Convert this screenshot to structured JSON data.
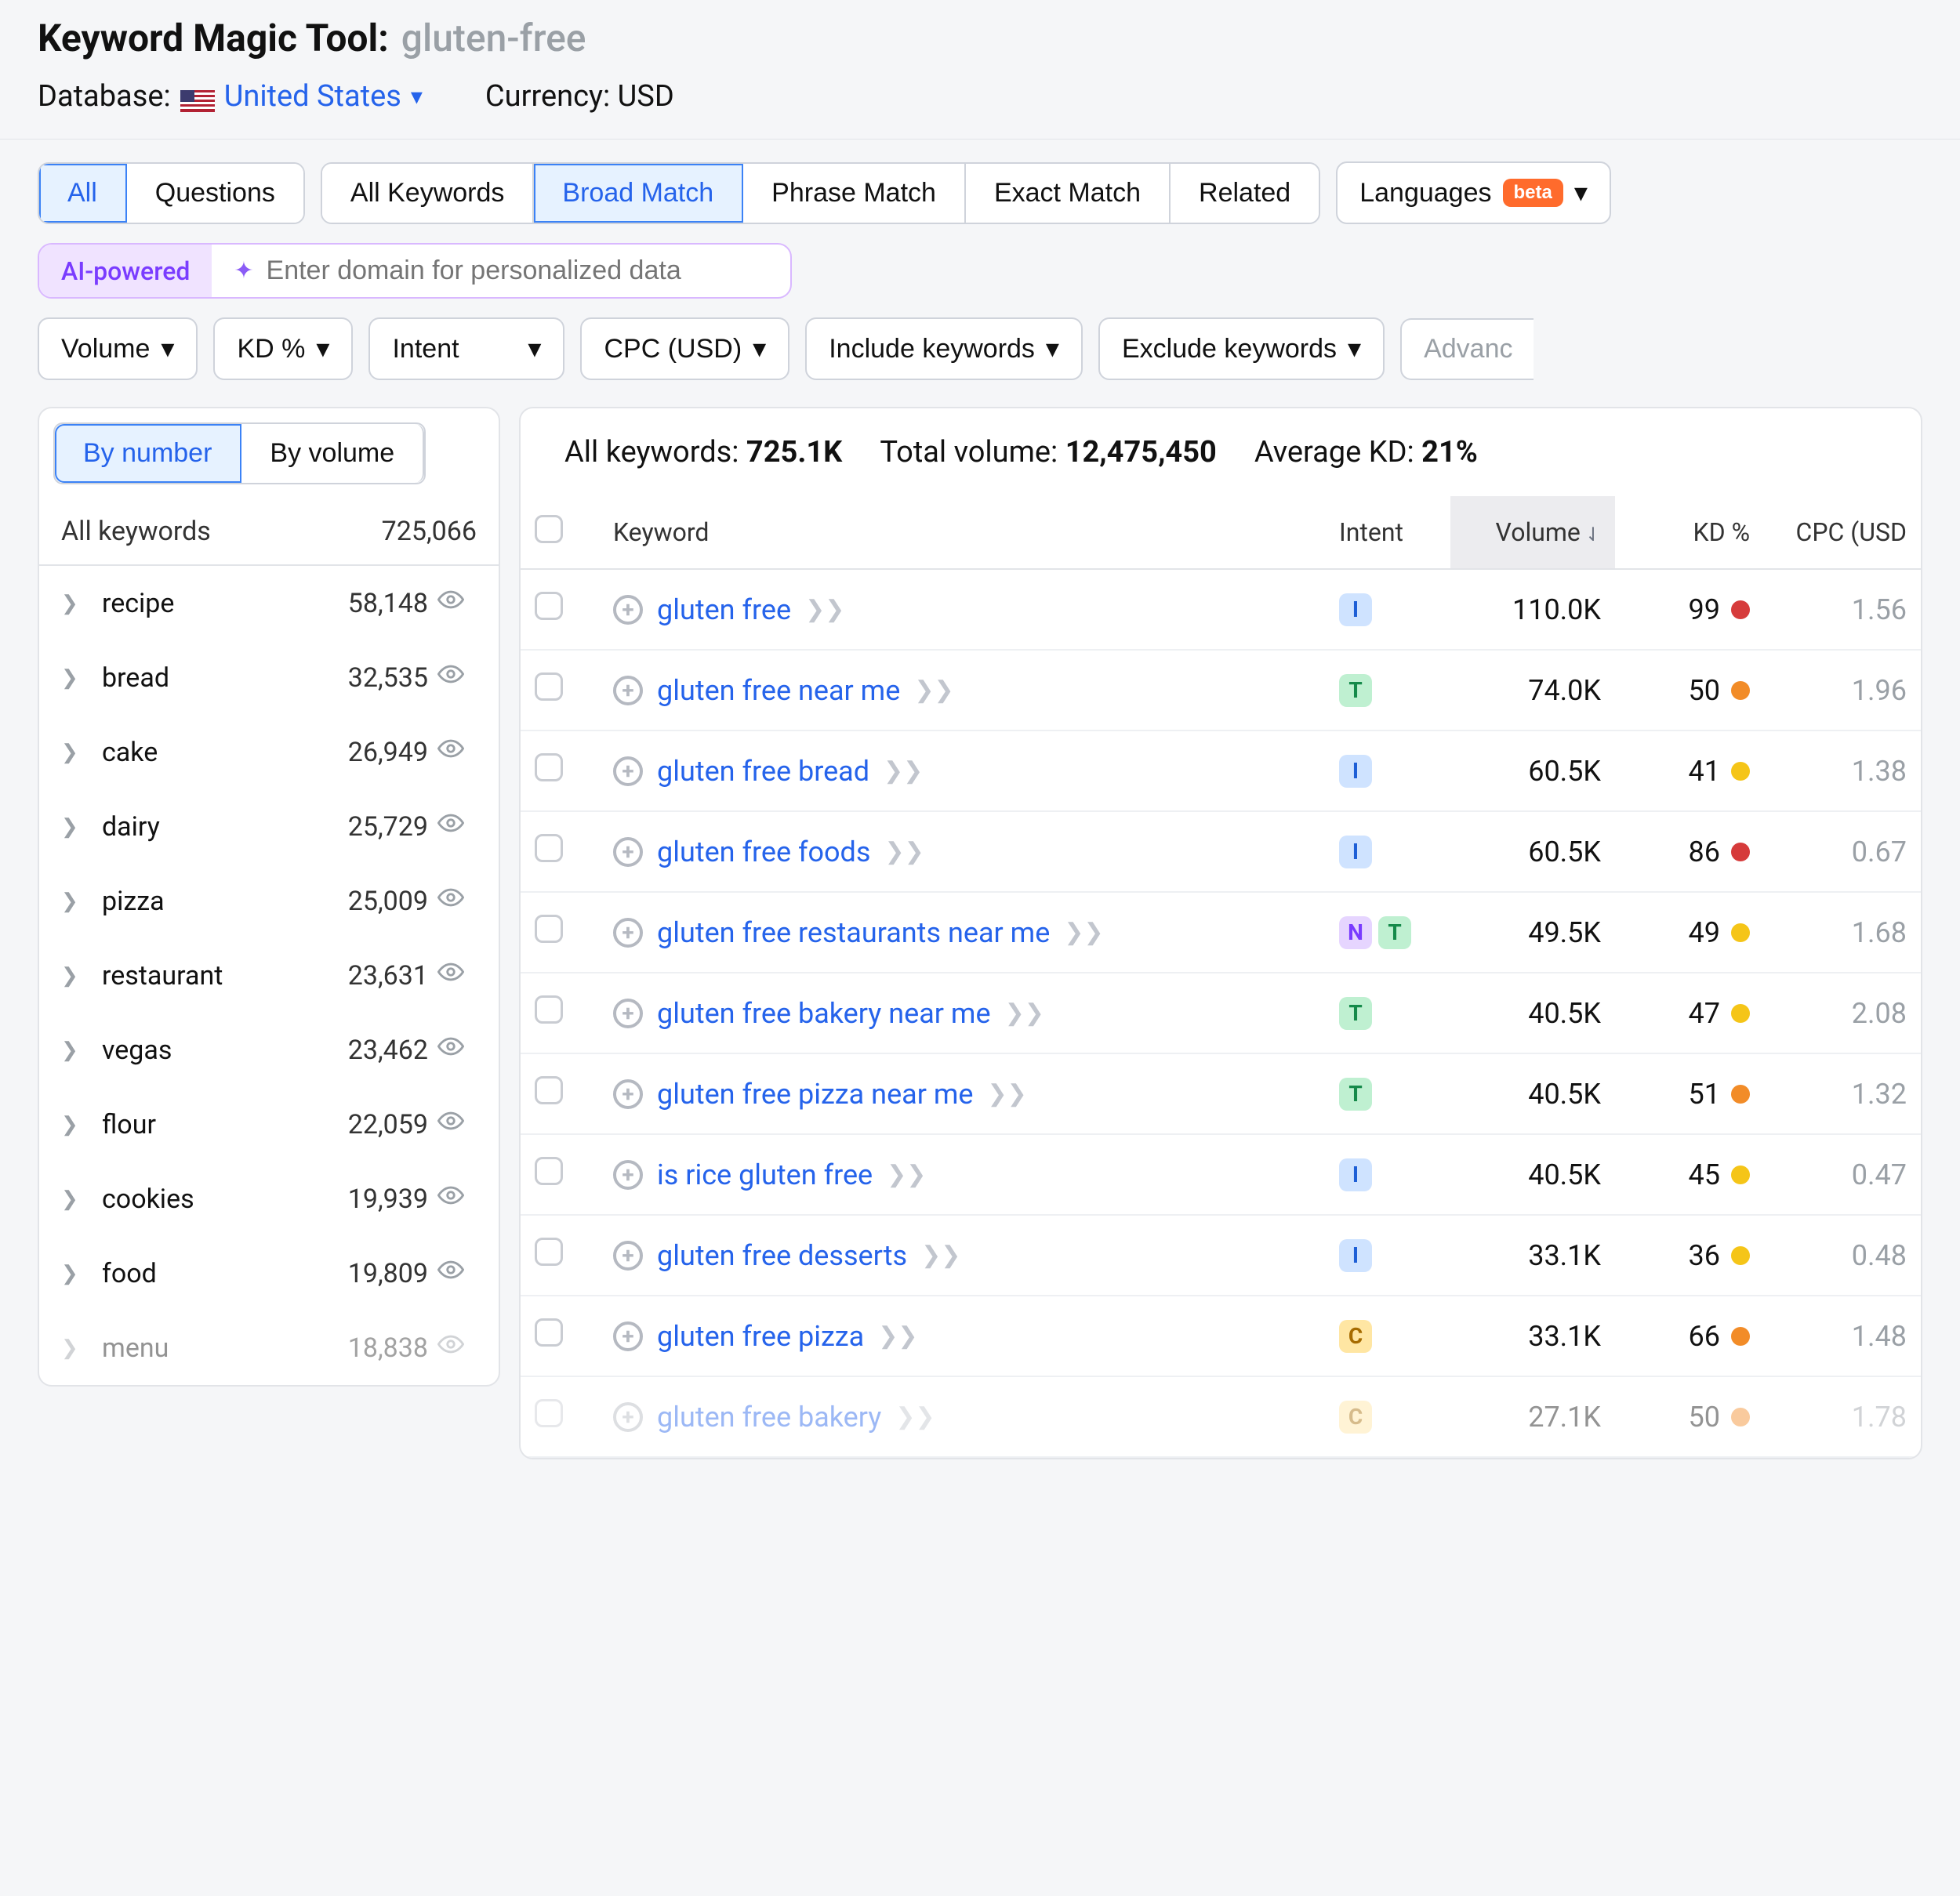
{
  "header": {
    "title": "Keyword Magic Tool:",
    "query": "gluten-free",
    "database_label": "Database:",
    "country": "United States",
    "currency_label": "Currency:",
    "currency": "USD"
  },
  "tabs_scope": {
    "all": "All",
    "questions": "Questions"
  },
  "tabs_match": {
    "all_keywords": "All Keywords",
    "broad": "Broad Match",
    "phrase": "Phrase Match",
    "exact": "Exact Match",
    "related": "Related"
  },
  "languages": {
    "label": "Languages",
    "badge": "beta"
  },
  "ai": {
    "pill": "AI-powered",
    "placeholder": "Enter domain for personalized data"
  },
  "filters": {
    "volume": "Volume",
    "kd": "KD %",
    "intent": "Intent",
    "cpc": "CPC (USD)",
    "include": "Include keywords",
    "exclude": "Exclude keywords",
    "advanced": "Advanc"
  },
  "sidebar": {
    "by_number": "By number",
    "by_volume": "By volume",
    "all_kw_label": "All keywords",
    "all_kw_count": "725,066",
    "items": [
      {
        "label": "recipe",
        "count": "58,148"
      },
      {
        "label": "bread",
        "count": "32,535"
      },
      {
        "label": "cake",
        "count": "26,949"
      },
      {
        "label": "dairy",
        "count": "25,729"
      },
      {
        "label": "pizza",
        "count": "25,009"
      },
      {
        "label": "restaurant",
        "count": "23,631"
      },
      {
        "label": "vegas",
        "count": "23,462"
      },
      {
        "label": "flour",
        "count": "22,059"
      },
      {
        "label": "cookies",
        "count": "19,939"
      },
      {
        "label": "food",
        "count": "19,809"
      },
      {
        "label": "menu",
        "count": "18,838"
      }
    ]
  },
  "summary": {
    "all_kw_label": "All keywords:",
    "all_kw_val": "725.1K",
    "total_label": "Total volume:",
    "total_val": "12,475,450",
    "avg_label": "Average KD:",
    "avg_val": "21%"
  },
  "columns": {
    "keyword": "Keyword",
    "intent": "Intent",
    "volume": "Volume",
    "kd": "KD %",
    "cpc": "CPC (USD"
  },
  "rows": [
    {
      "keyword": "gluten free",
      "intents": [
        "I"
      ],
      "volume": "110.0K",
      "kd": "99",
      "kd_color": "red",
      "cpc": "1.56"
    },
    {
      "keyword": "gluten free near me",
      "intents": [
        "T"
      ],
      "volume": "74.0K",
      "kd": "50",
      "kd_color": "orange",
      "cpc": "1.96"
    },
    {
      "keyword": "gluten free bread",
      "intents": [
        "I"
      ],
      "volume": "60.5K",
      "kd": "41",
      "kd_color": "yellow",
      "cpc": "1.38"
    },
    {
      "keyword": "gluten free foods",
      "intents": [
        "I"
      ],
      "volume": "60.5K",
      "kd": "86",
      "kd_color": "red",
      "cpc": "0.67"
    },
    {
      "keyword": "gluten free restaurants near me",
      "intents": [
        "N",
        "T"
      ],
      "volume": "49.5K",
      "kd": "49",
      "kd_color": "yellow",
      "cpc": "1.68"
    },
    {
      "keyword": "gluten free bakery near me",
      "intents": [
        "T"
      ],
      "volume": "40.5K",
      "kd": "47",
      "kd_color": "yellow",
      "cpc": "2.08"
    },
    {
      "keyword": "gluten free pizza near me",
      "intents": [
        "T"
      ],
      "volume": "40.5K",
      "kd": "51",
      "kd_color": "orange",
      "cpc": "1.32"
    },
    {
      "keyword": "is rice gluten free",
      "intents": [
        "I"
      ],
      "volume": "40.5K",
      "kd": "45",
      "kd_color": "yellow",
      "cpc": "0.47"
    },
    {
      "keyword": "gluten free desserts",
      "intents": [
        "I"
      ],
      "volume": "33.1K",
      "kd": "36",
      "kd_color": "yellow",
      "cpc": "0.48"
    },
    {
      "keyword": "gluten free pizza",
      "intents": [
        "C"
      ],
      "volume": "33.1K",
      "kd": "66",
      "kd_color": "orange",
      "cpc": "1.48"
    },
    {
      "keyword": "gluten free bakery",
      "intents": [
        "C"
      ],
      "volume": "27.1K",
      "kd": "50",
      "kd_color": "orange",
      "cpc": "1.78",
      "faded": true
    }
  ]
}
